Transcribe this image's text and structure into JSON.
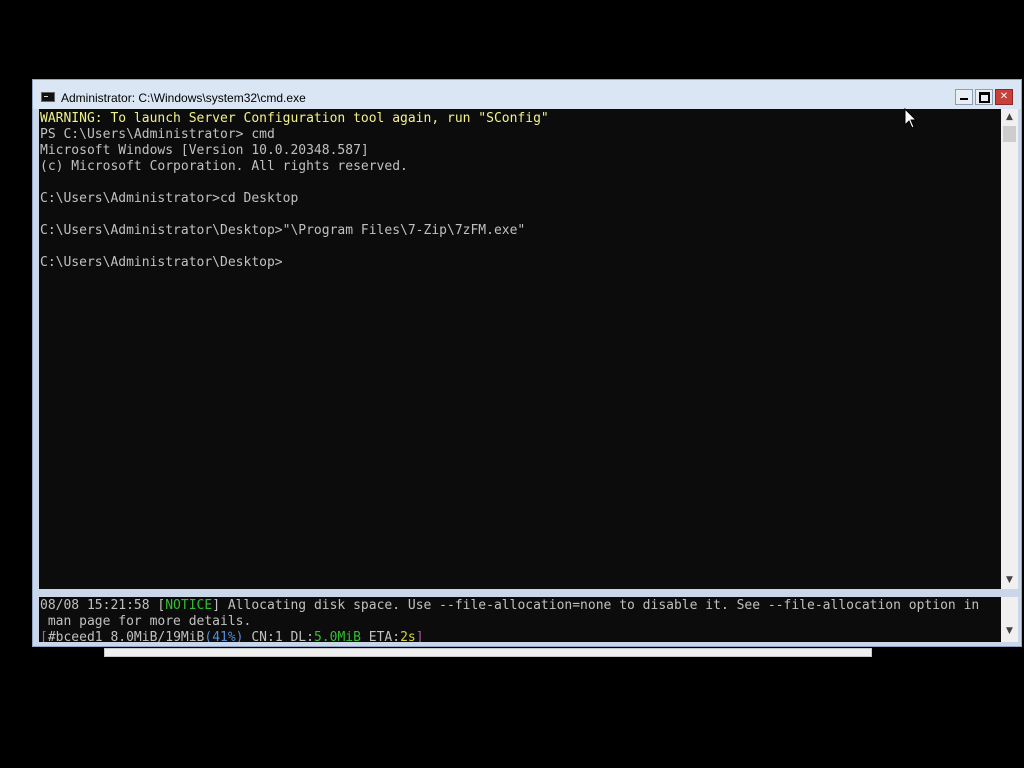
{
  "window": {
    "title": "Administrator: C:\\Windows\\system32\\cmd.exe",
    "icon": "cmd-icon"
  },
  "controls": {
    "minimize": "minimize-icon",
    "maximize": "maximize-icon",
    "close": "✕"
  },
  "console": {
    "lines": [
      "WARNING: To launch Server Configuration tool again, run \"SConfig\"",
      "PS C:\\Users\\Administrator> cmd",
      "Microsoft Windows [Version 10.0.20348.587]",
      "(c) Microsoft Corporation. All rights reserved.",
      "",
      "C:\\Users\\Administrator>cd Desktop",
      "",
      "C:\\Users\\Administrator\\Desktop>\"\\Program Files\\7-Zip\\7zFM.exe\"",
      "",
      "C:\\Users\\Administrator\\Desktop>"
    ]
  },
  "status": {
    "timestamp": "08/08 15:21:58",
    "bracket_open": "[",
    "level": "NOTICE",
    "bracket_close": "]",
    "message": " Allocating disk space. Use --file-allocation=none to disable it. See --file-allocation option in",
    "message_cont": " man page for more details.",
    "progress_prefix": "[",
    "gid": "#bceed1",
    "size": " 8.0MiB/19MiB",
    "percent": "(41%)",
    "cn": " CN:1",
    "dl_label": " DL:",
    "dl_speed": "5.0MiB",
    "eta_label": " ETA:",
    "eta": "2s",
    "progress_suffix": "]",
    "progress_fraction": 0.41
  },
  "colors": {
    "warning": "#f2f28a",
    "notice": "#2fbf2f",
    "percent": "#4f8fd8",
    "close_button": "#c7403a"
  }
}
